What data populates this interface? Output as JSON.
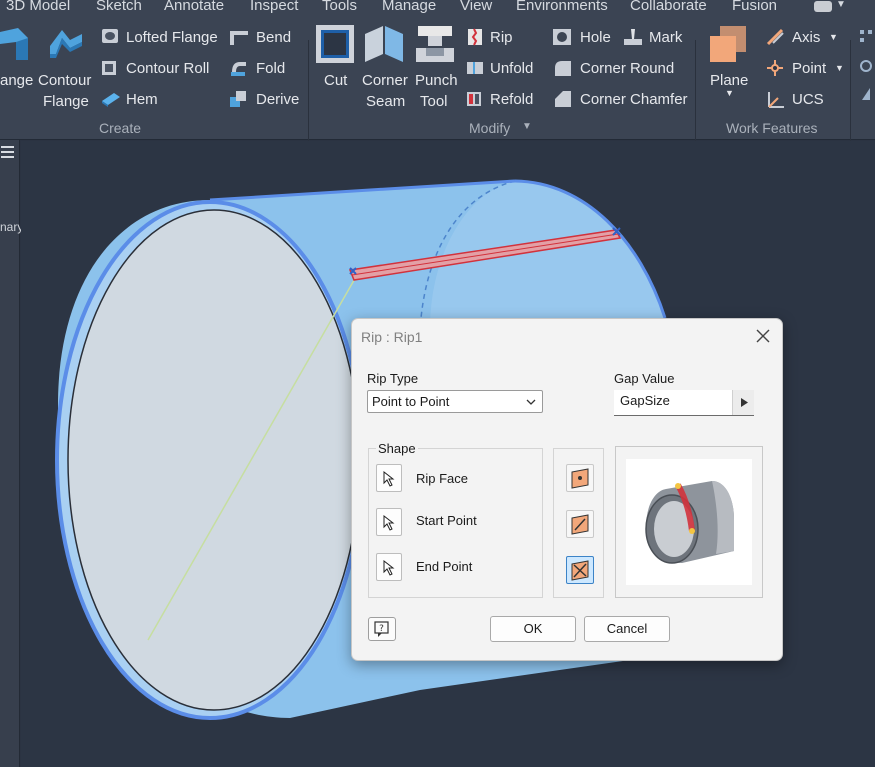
{
  "menu": {
    "tabs": [
      "3D Model",
      "Sketch",
      "Annotate",
      "Inspect",
      "Tools",
      "Manage",
      "View",
      "Environments",
      "Collaborate",
      "Fusion"
    ]
  },
  "ribbon": {
    "create": {
      "title": "Create",
      "flange_label": "ange",
      "contour_flange_line1": "Contour",
      "contour_flange_line2": "Flange",
      "lofted_flange": "Lofted Flange",
      "contour_roll": "Contour Roll",
      "hem": "Hem",
      "bend": "Bend",
      "fold": "Fold",
      "derive": "Derive"
    },
    "modify": {
      "title": "Modify",
      "cut": "Cut",
      "corner_seam_line1": "Corner",
      "corner_seam_line2": "Seam",
      "punch_tool_line1": "Punch",
      "punch_tool_line2": "Tool",
      "rip": "Rip",
      "unfold": "Unfold",
      "refold": "Refold",
      "hole": "Hole",
      "corner_round": "Corner Round",
      "corner_chamfer": "Corner Chamfer",
      "mark": "Mark"
    },
    "work_features": {
      "title": "Work Features",
      "plane": "Plane",
      "axis": "Axis",
      "point": "Point",
      "ucs": "UCS"
    }
  },
  "browser": {
    "partial_label": "nary"
  },
  "dialog": {
    "title": "Rip : Rip1",
    "rip_type_label": "Rip Type",
    "rip_type_value": "Point to Point",
    "gap_value_label": "Gap Value",
    "gap_value": "GapSize",
    "shape_label": "Shape",
    "rip_face": "Rip Face",
    "start_point": "Start Point",
    "end_point": "End Point",
    "ok": "OK",
    "cancel": "Cancel"
  },
  "colors": {
    "ribbon_bg": "#3b4453",
    "viewport_bg": "#2c3544",
    "part_blue": "#8cc2ec",
    "part_edge": "#5b8de8",
    "rip_red": "#d2323c",
    "dialog_bg": "#f3f3f3",
    "plane_orange": "#f2a77a"
  }
}
